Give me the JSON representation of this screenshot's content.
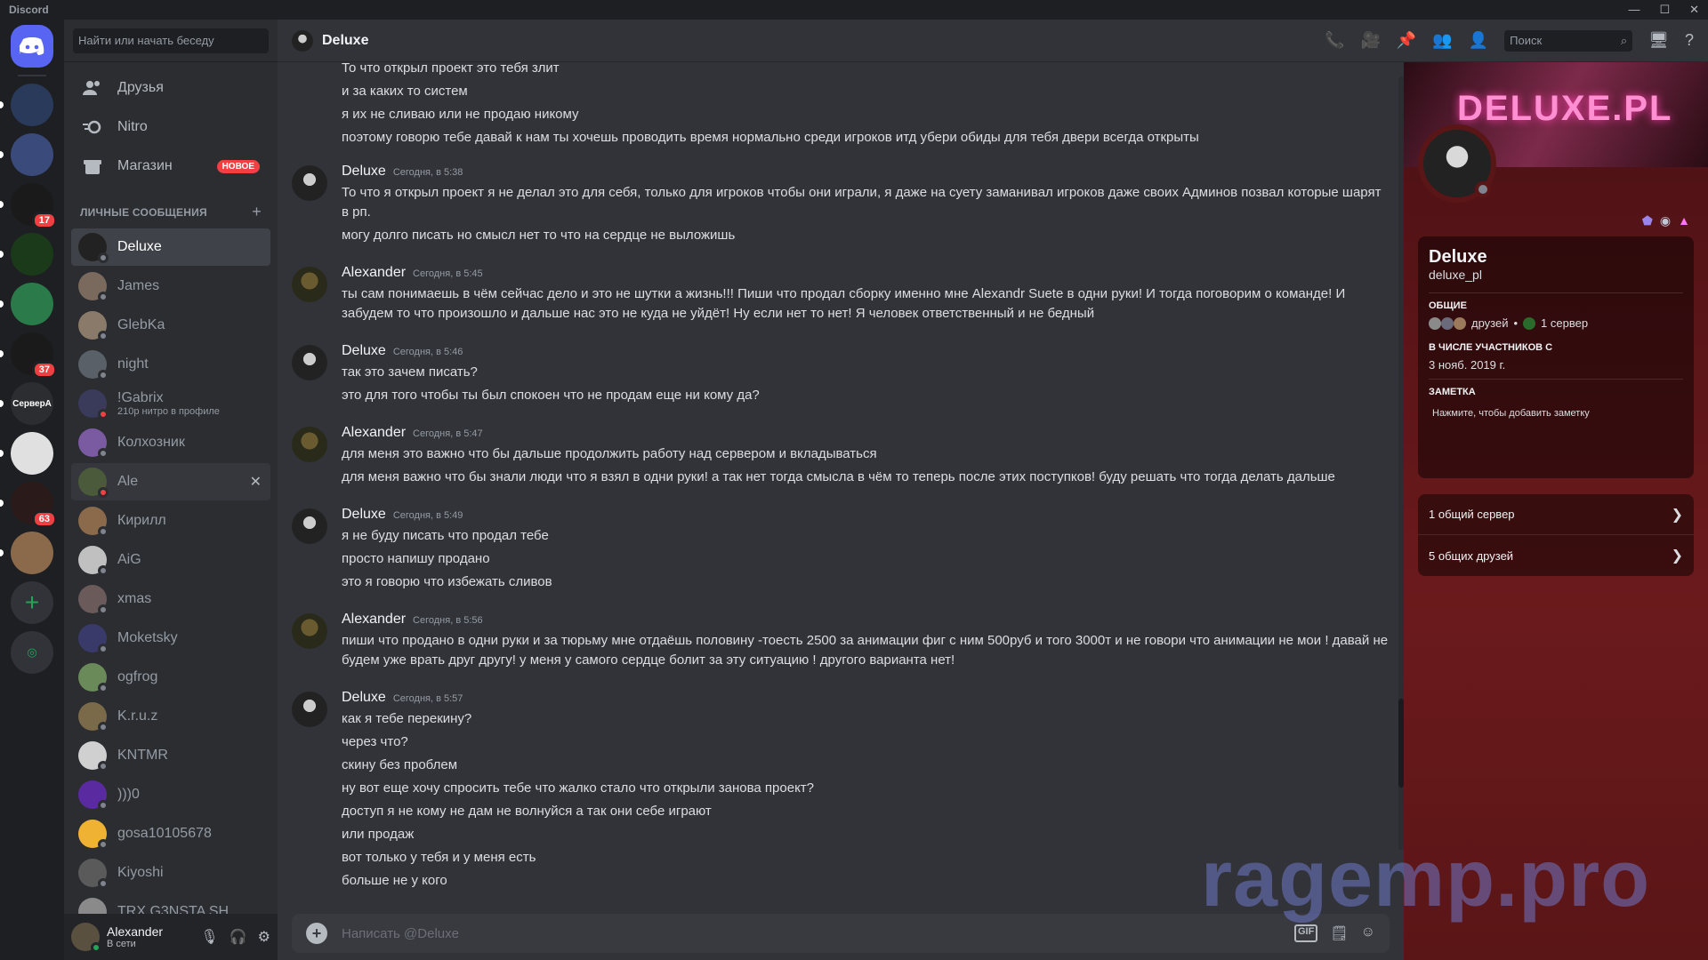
{
  "window": {
    "app_name": "Discord",
    "controls": [
      "—",
      "☐",
      "✕"
    ]
  },
  "servers": [
    {
      "name": "home",
      "badge": ""
    },
    {
      "name": "server-2",
      "badge": ""
    },
    {
      "name": "server-3",
      "badge": ""
    },
    {
      "name": "server-4",
      "badge": "17"
    },
    {
      "name": "server-5",
      "badge": ""
    },
    {
      "name": "server-6",
      "badge": ""
    },
    {
      "name": "server-7",
      "badge": "37"
    },
    {
      "name": "server-8",
      "label": "СерверА",
      "badge": ""
    },
    {
      "name": "server-9",
      "badge": ""
    },
    {
      "name": "server-10",
      "badge": "63"
    },
    {
      "name": "server-11",
      "badge": ""
    }
  ],
  "dm_sidebar": {
    "search_placeholder": "Найти или начать беседу",
    "nav": [
      {
        "label": "Друзья"
      },
      {
        "label": "Nitro"
      },
      {
        "label": "Магазин",
        "badge": "НОВОЕ"
      }
    ],
    "section_title": "ЛИЧНЫЕ СООБЩЕНИЯ",
    "section_plus": "+",
    "dms": [
      {
        "name": "Deluxe",
        "sub": "",
        "status": "offline",
        "color": "#222222"
      },
      {
        "name": "James",
        "sub": "",
        "status": "offline",
        "color": "#7a6a5e"
      },
      {
        "name": "GlebKa",
        "sub": "",
        "status": "offline",
        "color": "#8a7a6a"
      },
      {
        "name": "night",
        "sub": "",
        "status": "offline",
        "color": "#5a6068"
      },
      {
        "name": "!Gabrix",
        "sub": "210р нитро в профиле",
        "status": "dnd",
        "color": "#3a3a5a"
      },
      {
        "name": "Колхозник",
        "sub": "",
        "status": "offline",
        "color": "#7a5aa0"
      },
      {
        "name": "Ale",
        "sub": "",
        "status": "dnd",
        "color": "#4a5a3a"
      },
      {
        "name": "Кирилл",
        "sub": "",
        "status": "offline",
        "color": "#8a6a4a"
      },
      {
        "name": "AiG",
        "sub": "",
        "status": "offline",
        "color": "#c0c0c0"
      },
      {
        "name": "xmas",
        "sub": "",
        "status": "offline",
        "color": "#6a5a5a"
      },
      {
        "name": "Moketsky",
        "sub": "",
        "status": "offline",
        "color": "#3a3a6a"
      },
      {
        "name": "ogfrog",
        "sub": "",
        "status": "offline",
        "color": "#6a8a5a"
      },
      {
        "name": "K.r.u.z",
        "sub": "",
        "status": "offline",
        "color": "#7a6a4a"
      },
      {
        "name": "KNTMR",
        "sub": "",
        "status": "offline",
        "color": "#d0d0d0"
      },
      {
        "name": ")))0",
        "sub": "",
        "status": "offline",
        "color": "#5a2aa0"
      },
      {
        "name": "gosa10105678",
        "sub": "",
        "status": "offline",
        "color": "#f0b232"
      },
      {
        "name": "Kiyoshi",
        "sub": "",
        "status": "offline",
        "color": "#5a5a5a"
      },
      {
        "name": "TRX G3NSTA SH",
        "sub": "",
        "status": "offline",
        "color": "#8a8a8a"
      }
    ]
  },
  "user_panel": {
    "name": "Alexander",
    "status": "В сети"
  },
  "topbar": {
    "title": "Deluxe",
    "search_placeholder": "Поиск"
  },
  "messages": [
    {
      "author": "",
      "time": "",
      "lines": [
        "То что открыл проект это тебя злит",
        "и за каких то систем",
        "я их не сливаю или не продаю никому",
        "поэтому говорю тебе давай к нам ты хочешь проводить время нормально среди игроков итд убери обиды для тебя двери всегда открыты"
      ]
    },
    {
      "author": "Deluxe",
      "time": "Сегодня, в 5:38",
      "lines": [
        "То что я открыл проект я не делал это для себя, только для игроков чтобы они играли, я даже на суету заманивал игроков даже своих Админов позвал которые шарят в рп.",
        "могу долго писать но смысл нет то что на сердце не выложишь"
      ]
    },
    {
      "author": "Alexander",
      "time": "Сегодня, в 5:45",
      "lines": [
        "ты сам понимаешь в чём сейчас дело и это не шутки а жизнь!!! Пиши что продал сборку именно мне Alexandr Suete в одни руки! И тогда поговорим о команде! И забудем то что произошло и дальше нас это не куда не уйдёт! Ну если нет то нет! Я человек ответственный и не бедный"
      ]
    },
    {
      "author": "Deluxe",
      "time": "Сегодня, в 5:46",
      "lines": [
        "так это зачем писать?",
        "это для того чтобы ты был спокоен что не продам еще ни кому да?"
      ]
    },
    {
      "author": "Alexander",
      "time": "Сегодня, в 5:47",
      "lines": [
        "для меня это важно что бы дальше продолжить работу над сервером и вкладываться",
        "для меня важно что бы знали люди что я взял в одни руки! а так нет тогда смысла в чём то теперь после этих поступков! буду решать что тогда делать дальше"
      ]
    },
    {
      "author": "Deluxe",
      "time": "Сегодня, в 5:49",
      "lines": [
        "я не буду писать что продал тебе",
        "просто напишу продано",
        "это я говорю что избежать сливов"
      ]
    },
    {
      "author": "Alexander",
      "time": "Сегодня, в 5:56",
      "lines": [
        "пиши что продано в одни руки и за тюрьму мне отдаёшь половину -тоесть 2500 за анимации фиг с ним 500руб и того 3000т и не говори что анимации не мои ! давай не будем уже врать друг другу!  у меня у самого сердце болит за эту ситуацию ! другого варианта нет!"
      ]
    },
    {
      "author": "Deluxe",
      "time": "Сегодня, в 5:57",
      "lines": [
        "как я тебе перекину?",
        "через что?",
        "скину без проблем",
        "ну вот еще хочу спросить тебе что жалко стало что открыли занова проект?",
        "доступ я не кому не дам не волнуйся а так они себе играют",
        "или продаж",
        "вот только у тебя и у меня есть",
        "больше не у кого"
      ]
    }
  ],
  "composer": {
    "placeholder": "Написать @Deluxe",
    "gif": "GIF"
  },
  "profile": {
    "banner_text": "DELUXE.PL",
    "display_name": "Deluxe",
    "username": "deluxe_pl",
    "common_title": "ОБЩИЕ",
    "friends_label": "друзей",
    "servers_label": "1 сервер",
    "member_since_title": "В ЧИСЛЕ УЧАСТНИКОВ С",
    "member_since": "3 нояб. 2019 г.",
    "note_title": "ЗАМЕТКА",
    "note_placeholder": "Нажмите, чтобы добавить заметку",
    "mutual_servers": "1 общий сервер",
    "mutual_friends": "5 общих друзей"
  },
  "watermark": "ragemp.pro",
  "colors": {
    "accent": "#5865f2",
    "online": "#23a559",
    "dnd": "#f23f43",
    "offline": "#80848e",
    "badge": "#f23f43"
  }
}
